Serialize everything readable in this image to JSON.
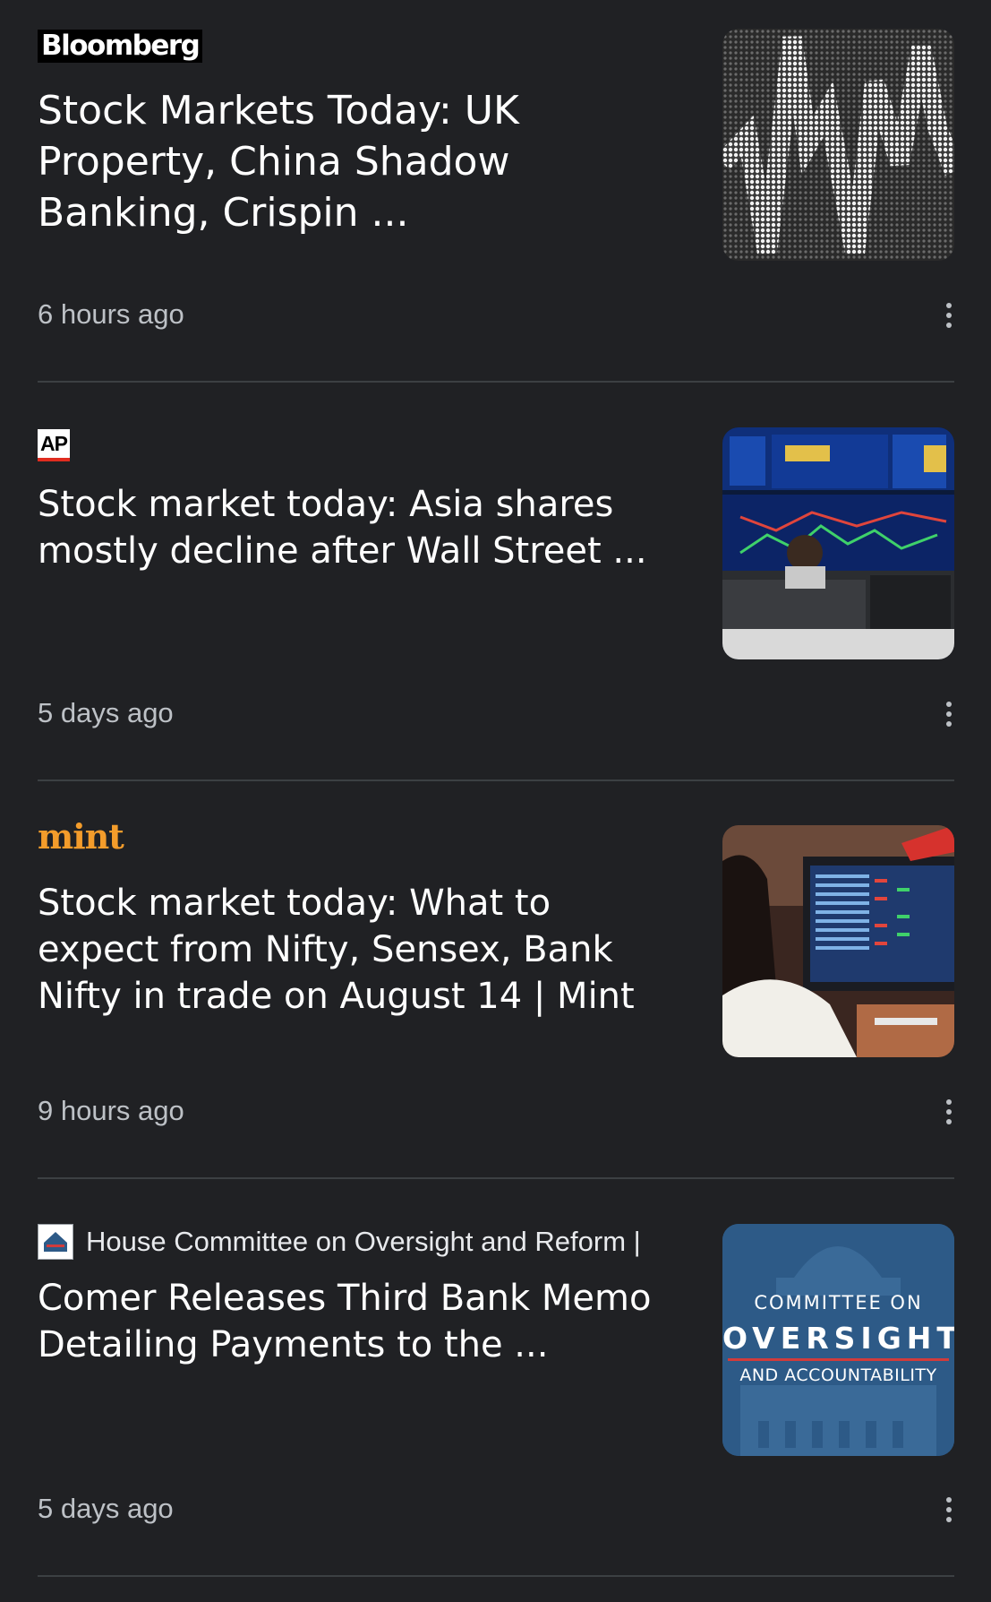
{
  "articles": [
    {
      "publisher": "Bloomberg",
      "title": "Stock Markets Today: UK Property, China Shadow Banking, Crispin ...",
      "time": "6 hours ago"
    },
    {
      "publisher": "AP",
      "title": "Stock market today: Asia shares mostly decline after Wall Street ...",
      "time": "5 days ago"
    },
    {
      "publisher": "mint",
      "title": "Stock market today: What to expect from Nifty, Sensex, Bank Nifty in trade on August 14 | Mint",
      "time": "9 hours ago"
    },
    {
      "publisher": "House Committee on Oversight and Reform |",
      "title": "Comer Releases Third Bank Memo Detailing Payments to the ...",
      "time": "5 days ago",
      "thumbnail_text": {
        "line1": "COMMITTEE ON",
        "line2": "OVERSIGHT",
        "line3": "AND ACCOUNTABILITY"
      }
    }
  ],
  "icons": {
    "more": "more-vert-icon"
  },
  "colors": {
    "background": "#202124",
    "mint_brand": "#f39c2b",
    "ap_red": "#e02c1f"
  }
}
